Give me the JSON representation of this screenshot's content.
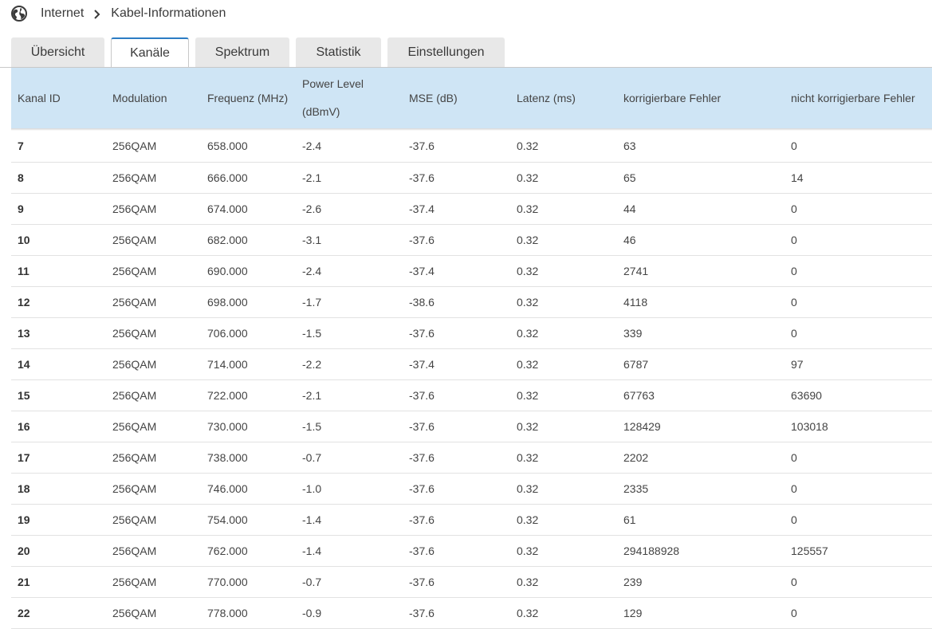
{
  "breadcrumb": {
    "icon": "globe-icon",
    "root": "Internet",
    "current": "Kabel-Informationen"
  },
  "tabs": [
    {
      "label": "Übersicht",
      "active": false
    },
    {
      "label": "Kanäle",
      "active": true
    },
    {
      "label": "Spektrum",
      "active": false
    },
    {
      "label": "Statistik",
      "active": false
    },
    {
      "label": "Einstellungen",
      "active": false
    }
  ],
  "colors": {
    "accent": "#2c7cc4",
    "header_bg": "#cfe5f5",
    "tab_bg": "#e8e8e8"
  },
  "table": {
    "headers": {
      "id": "Kanal ID",
      "modulation": "Modulation",
      "frequency": "Frequenz (MHz)",
      "power_line1": "Power Level",
      "power_line2": "(dBmV)",
      "mse": "MSE (dB)",
      "latency": "Latenz (ms)",
      "correctable": "korrigierbare Fehler",
      "uncorrectable": "nicht korrigierbare Fehler"
    },
    "rows": [
      {
        "id": "7",
        "modulation": "256QAM",
        "frequency": "658.000",
        "power": "-2.4",
        "mse": "-37.6",
        "latency": "0.32",
        "correctable": "63",
        "uncorrectable": "0"
      },
      {
        "id": "8",
        "modulation": "256QAM",
        "frequency": "666.000",
        "power": "-2.1",
        "mse": "-37.6",
        "latency": "0.32",
        "correctable": "65",
        "uncorrectable": "14"
      },
      {
        "id": "9",
        "modulation": "256QAM",
        "frequency": "674.000",
        "power": "-2.6",
        "mse": "-37.4",
        "latency": "0.32",
        "correctable": "44",
        "uncorrectable": "0"
      },
      {
        "id": "10",
        "modulation": "256QAM",
        "frequency": "682.000",
        "power": "-3.1",
        "mse": "-37.6",
        "latency": "0.32",
        "correctable": "46",
        "uncorrectable": "0"
      },
      {
        "id": "11",
        "modulation": "256QAM",
        "frequency": "690.000",
        "power": "-2.4",
        "mse": "-37.4",
        "latency": "0.32",
        "correctable": "2741",
        "uncorrectable": "0"
      },
      {
        "id": "12",
        "modulation": "256QAM",
        "frequency": "698.000",
        "power": "-1.7",
        "mse": "-38.6",
        "latency": "0.32",
        "correctable": "4118",
        "uncorrectable": "0"
      },
      {
        "id": "13",
        "modulation": "256QAM",
        "frequency": "706.000",
        "power": "-1.5",
        "mse": "-37.6",
        "latency": "0.32",
        "correctable": "339",
        "uncorrectable": "0"
      },
      {
        "id": "14",
        "modulation": "256QAM",
        "frequency": "714.000",
        "power": "-2.2",
        "mse": "-37.4",
        "latency": "0.32",
        "correctable": "6787",
        "uncorrectable": "97"
      },
      {
        "id": "15",
        "modulation": "256QAM",
        "frequency": "722.000",
        "power": "-2.1",
        "mse": "-37.6",
        "latency": "0.32",
        "correctable": "67763",
        "uncorrectable": "63690"
      },
      {
        "id": "16",
        "modulation": "256QAM",
        "frequency": "730.000",
        "power": "-1.5",
        "mse": "-37.6",
        "latency": "0.32",
        "correctable": "128429",
        "uncorrectable": "103018"
      },
      {
        "id": "17",
        "modulation": "256QAM",
        "frequency": "738.000",
        "power": "-0.7",
        "mse": "-37.6",
        "latency": "0.32",
        "correctable": "2202",
        "uncorrectable": "0"
      },
      {
        "id": "18",
        "modulation": "256QAM",
        "frequency": "746.000",
        "power": "-1.0",
        "mse": "-37.6",
        "latency": "0.32",
        "correctable": "2335",
        "uncorrectable": "0"
      },
      {
        "id": "19",
        "modulation": "256QAM",
        "frequency": "754.000",
        "power": "-1.4",
        "mse": "-37.6",
        "latency": "0.32",
        "correctable": "61",
        "uncorrectable": "0"
      },
      {
        "id": "20",
        "modulation": "256QAM",
        "frequency": "762.000",
        "power": "-1.4",
        "mse": "-37.6",
        "latency": "0.32",
        "correctable": "294188928",
        "uncorrectable": "125557"
      },
      {
        "id": "21",
        "modulation": "256QAM",
        "frequency": "770.000",
        "power": "-0.7",
        "mse": "-37.6",
        "latency": "0.32",
        "correctable": "239",
        "uncorrectable": "0"
      },
      {
        "id": "22",
        "modulation": "256QAM",
        "frequency": "778.000",
        "power": "-0.9",
        "mse": "-37.6",
        "latency": "0.32",
        "correctable": "129",
        "uncorrectable": "0"
      }
    ]
  }
}
